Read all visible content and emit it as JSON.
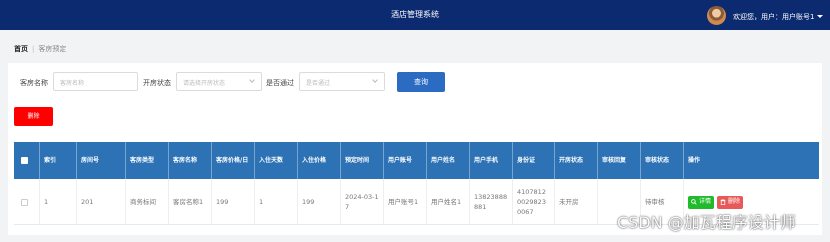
{
  "header": {
    "title": "酒店管理系统",
    "user_greeting": "欢迎您，用户：用户账号1"
  },
  "breadcrumb": {
    "home": "首页",
    "current": "客房预定"
  },
  "search": {
    "room_name_label": "客房名称",
    "room_name_placeholder": "客房名称",
    "room_status_label": "开房状态",
    "room_status_placeholder": "请选择开房状态",
    "approved_label": "是否通过",
    "approved_placeholder": "是否通过",
    "query_label": "查询"
  },
  "toolbar": {
    "delete_label": "删除"
  },
  "table": {
    "columns": [
      "索引",
      "房间号",
      "客房类型",
      "客房名称",
      "客房价格/日",
      "入住天数",
      "入住价格",
      "预定时间",
      "用户账号",
      "用户姓名",
      "用户手机",
      "身份证",
      "开房状态",
      "审核回复",
      "审核状态",
      "操作"
    ],
    "rows": [
      {
        "index": "1",
        "room_no": "201",
        "room_type": "商务标间",
        "room_name": "客房名称1",
        "price_per_day": "199",
        "days": "1",
        "total_price": "199",
        "booking_time": "2024-03-17",
        "account": "用户账号1",
        "name": "用户姓名1",
        "phone": "13823888881",
        "id_card": "410781200298230067",
        "room_status": "未开房",
        "review_reply": "",
        "review_status": "待审核",
        "detail_label": "详情",
        "delete_label": "删除"
      }
    ]
  },
  "watermark": "CSDN @加瓦程序设计师",
  "colors": {
    "header_bg": "#0b2a6f",
    "table_header_bg": "#2e72b6",
    "query_button": "#2b6cc2",
    "delete_button": "#ff0000",
    "detail_button": "#1fbb2c",
    "row_delete_button": "#e85a5a"
  }
}
